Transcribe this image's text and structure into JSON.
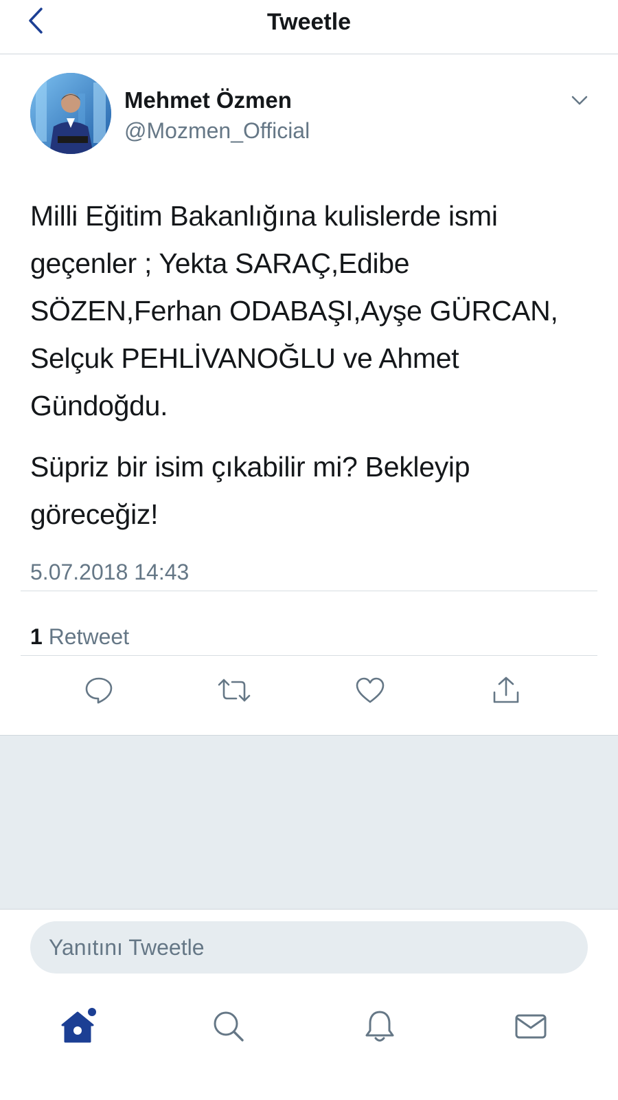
{
  "header": {
    "title": "Tweetle",
    "back_icon": "chevron-left-icon"
  },
  "author": {
    "name": "Mehmet Özmen",
    "handle": "@Mozmen_Official",
    "menu_icon": "chevron-down-icon"
  },
  "tweet": {
    "paragraphs": [
      "Milli Eğitim Bakanlığına kulislerde ismi geçenler ; Yekta SARAÇ,Edibe SÖZEN,Ferhan ODABAŞI,Ayşe GÜRCAN, Selçuk PEHLİVANOĞLU ve Ahmet Gündoğdu.",
      "Süpriz bir isim çıkabilir mi? Bekleyip göreceğiz!"
    ],
    "timestamp": "5.07.2018 14:43"
  },
  "stats": {
    "retweet_count": "1",
    "retweet_label": "Retweet"
  },
  "actions": [
    {
      "name": "reply",
      "icon": "comment-icon"
    },
    {
      "name": "retweet",
      "icon": "retweet-icon"
    },
    {
      "name": "like",
      "icon": "heart-icon"
    },
    {
      "name": "share",
      "icon": "share-icon"
    }
  ],
  "reply": {
    "placeholder": "Yanıtını Tweetle"
  },
  "tabbar": [
    {
      "name": "home",
      "icon": "home-icon",
      "active": true
    },
    {
      "name": "search",
      "icon": "search-icon",
      "active": false
    },
    {
      "name": "notifications",
      "icon": "bell-icon",
      "active": false
    },
    {
      "name": "messages",
      "icon": "mail-icon",
      "active": false
    }
  ],
  "colors": {
    "accent": "#1c3f94",
    "icon_gray": "#657786",
    "text": "#14171a",
    "background_gray": "#e6ecf0"
  }
}
